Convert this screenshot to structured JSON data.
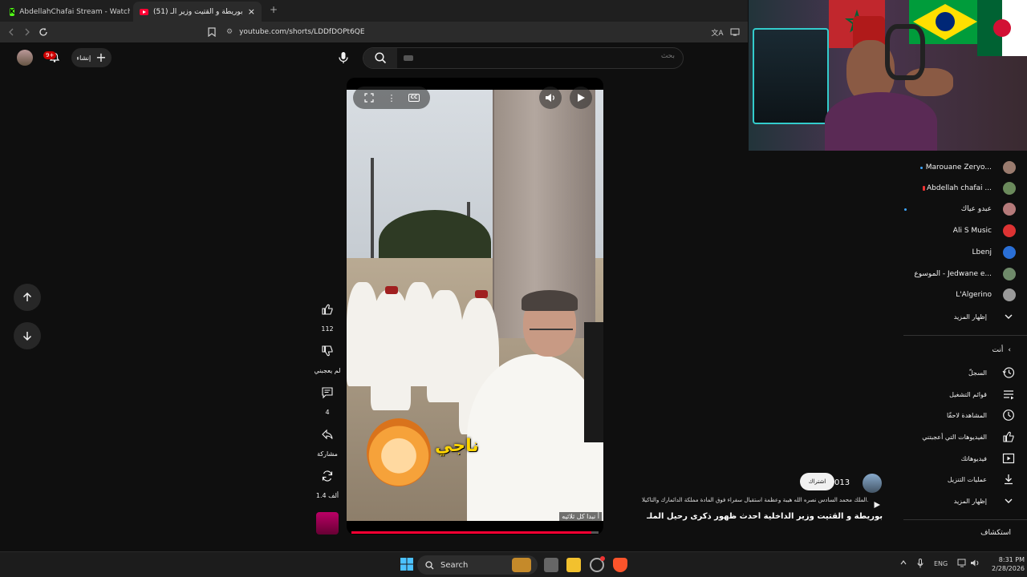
{
  "browser": {
    "tabs": [
      {
        "title": "AbdellahChafai Stream - Watch Live o",
        "active": false
      },
      {
        "title": "(51) ناصر بوريطة و القتيت وزير الـ",
        "active": true
      }
    ],
    "new_tab": "+",
    "close": "×",
    "url": "youtube.com/shorts/LDDfDOPt6QE"
  },
  "header": {
    "notifications_badge": "9+",
    "create_label": "إنشاء",
    "search_placeholder": "بحث"
  },
  "video": {
    "overlay_text": "ناجي",
    "caption": "أ نبدا كل ثلاثيه",
    "progress": 0.97
  },
  "actions": {
    "like_count": "112",
    "dislike_label": "لم يعجبني",
    "comment_count": "4",
    "share_label": "مشاركة",
    "remix_count": "1.4 ألف"
  },
  "meta": {
    "channel_name": "@013",
    "subscribe_label": "اشتراك",
    "description": "الملك محمد السادس نصره الله هيبة وعظمة استقبال سفراء فوق المادة مملكة الدائمارك والتاكيلا...",
    "title": "ناصر بوريطة و القتيت وزير الداخلية أحدث ظهور ذكرى رحيل الملـ..."
  },
  "subscriptions": [
    {
      "name": "Marouane Zeryo...",
      "color": "#9a7b6e",
      "live": "dot"
    },
    {
      "name": "Abdellah chafai ...",
      "color": "#6b8a5c",
      "live": "bar"
    },
    {
      "name": "عبدو عياك",
      "color": "#b57a7a",
      "live": "dot2"
    },
    {
      "name": "Ali S Music",
      "color": "#d33",
      "live": ""
    },
    {
      "name": "Lbenj",
      "color": "#2a6fd6",
      "live": ""
    },
    {
      "name": "الموسوع - Jedwane e...",
      "color": "#6f8a6a",
      "live": ""
    },
    {
      "name": "L'Algerino",
      "color": "#999",
      "live": ""
    }
  ],
  "show_more_subs": "إظهار المزيد",
  "you_section": {
    "heading": "أنت",
    "items": [
      {
        "label": "السجلّ",
        "icon": "history-icon"
      },
      {
        "label": "قوائم التشغيل",
        "icon": "playlists-icon"
      },
      {
        "label": "المشاهدة لاحقًا",
        "icon": "watch-later-icon"
      },
      {
        "label": "الفيديوهات التي أعجبتني",
        "icon": "liked-videos-icon"
      },
      {
        "label": "فيديوهاتك",
        "icon": "your-videos-icon"
      },
      {
        "label": "عمليات التنزيل",
        "icon": "downloads-icon"
      },
      {
        "label": "إظهار المزيد",
        "icon": "chevron-down-icon"
      }
    ]
  },
  "explore_heading": "استكشاف",
  "taskbar": {
    "search_label": "Search",
    "lang": "ENG",
    "time": "8:31 PM",
    "date": "2/28/2026"
  }
}
